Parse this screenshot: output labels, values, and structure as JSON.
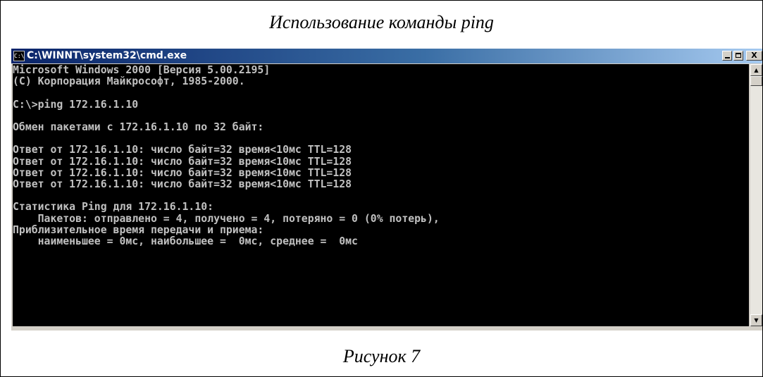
{
  "heading": "Использование команды ping",
  "caption": "Рисунок 7",
  "window": {
    "title": "C:\\WINNT\\system32\\cmd.exe",
    "icon_name": "cmd-icon",
    "icon_label": "C:\\",
    "controls": {
      "minimize": "",
      "maximize": "",
      "close": "X"
    }
  },
  "console": {
    "lines": [
      "Microsoft Windows 2000 [Версия 5.00.2195]",
      "(С) Корпорация Майкрософт, 1985-2000.",
      "",
      "C:\\>ping 172.16.1.10",
      "",
      "Обмен пакетами с 172.16.1.10 по 32 байт:",
      "",
      "Ответ от 172.16.1.10: число байт=32 время<10мс TTL=128",
      "Ответ от 172.16.1.10: число байт=32 время<10мс TTL=128",
      "Ответ от 172.16.1.10: число байт=32 время<10мс TTL=128",
      "Ответ от 172.16.1.10: число байт=32 время<10мс TTL=128",
      "",
      "Статистика Ping для 172.16.1.10:",
      "    Пакетов: отправлено = 4, получено = 4, потеряно = 0 (0% потерь),",
      "Приблизительное время передачи и приема:",
      "    наименьшее = 0мс, наибольшее =  0мс, среднее =  0мс"
    ]
  },
  "scrollbar": {
    "up_arrow": "▲",
    "down_arrow": "▼"
  },
  "colors": {
    "console_background": "#000000",
    "console_text": "#c0c0c0",
    "titlebar_start": "#0a246a",
    "titlebar_end": "#a6caf0"
  }
}
